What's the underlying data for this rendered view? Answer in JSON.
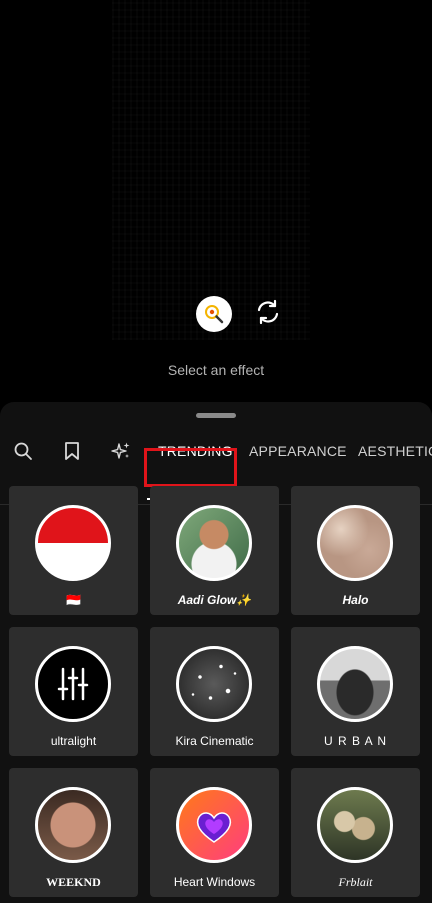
{
  "camera": {
    "hint": "Select an effect"
  },
  "tabs": {
    "search_icon": "search-icon",
    "saved_icon": "bookmark-icon",
    "new_icon": "sparkles-icon",
    "items": [
      "TRENDING",
      "APPEARANCE",
      "AESTHETIC"
    ],
    "active": "TRENDING",
    "highlight_color": "#e0141a"
  },
  "effects": [
    {
      "label": "🇮🇩",
      "thumb": "indonesia-flag"
    },
    {
      "label": "Aadi Glow✨",
      "thumb": "portrait-man-green"
    },
    {
      "label": "Halo",
      "thumb": "beige-texture"
    },
    {
      "label": "ultralight",
      "thumb": "equalizer-sliders"
    },
    {
      "label": "Kira Cinematic",
      "thumb": "sparkle-bokeh"
    },
    {
      "label": "U R B A N",
      "thumb": "car-bw"
    },
    {
      "label": "WEEKND",
      "thumb": "face-closeup"
    },
    {
      "label": "Heart Windows",
      "thumb": "purple-hearts"
    },
    {
      "label": "Frblait",
      "thumb": "group-photo"
    }
  ]
}
